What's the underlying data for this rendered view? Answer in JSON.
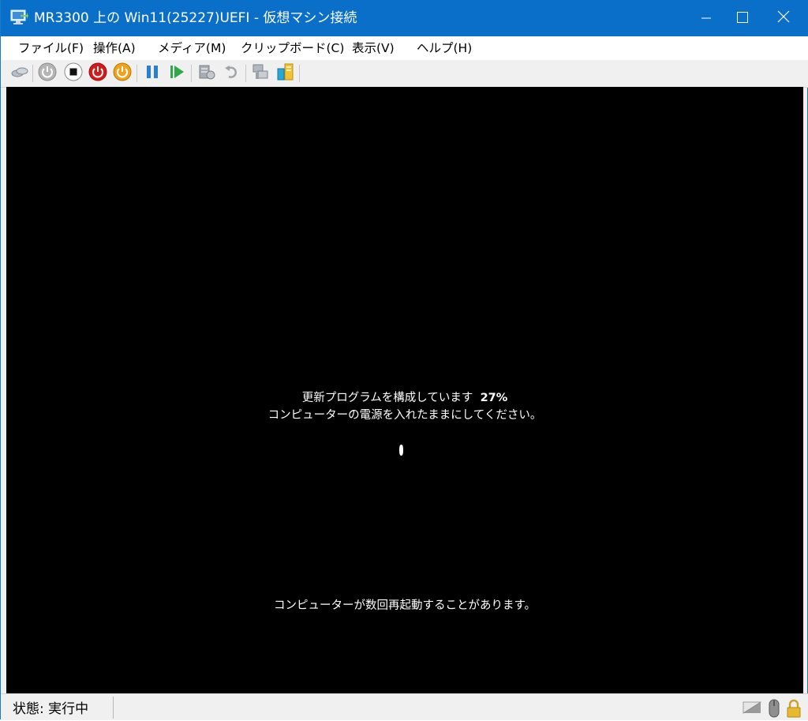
{
  "window": {
    "title": "MR3300 上の Win11(25227)UEFI  - 仮想マシン接続",
    "controls": [
      "minimize-icon",
      "maximize-icon",
      "close-icon"
    ]
  },
  "menu": {
    "items": [
      "ファイル(F)",
      "操作(A)",
      "メディア(M)",
      "クリップボード(C)",
      "表示(V)",
      "ヘルプ(H)"
    ]
  },
  "toolbar": {
    "buttons": [
      "ctrl-alt-del-icon",
      "start-icon",
      "turn-off-icon",
      "shutdown-icon",
      "save-icon",
      "pause-icon",
      "resume-icon",
      "checkpoint-icon",
      "revert-icon",
      "enhanced-session-icon",
      "share-icon"
    ]
  },
  "vm_screen": {
    "line1": "更新プログラムを構成しています",
    "percent": "27%",
    "line2": "コンピューターの電源を入れたままにしてください。",
    "line3": "コンピューターが数回再起動することがあります。"
  },
  "status": {
    "text": "状態: 実行中",
    "icons": [
      "keyboard-icon",
      "mouse-icon",
      "lock-icon"
    ]
  },
  "colors": {
    "titlebar": "#0a6fc9",
    "screen": "#000000",
    "statusbar": "#f0f0f0"
  }
}
